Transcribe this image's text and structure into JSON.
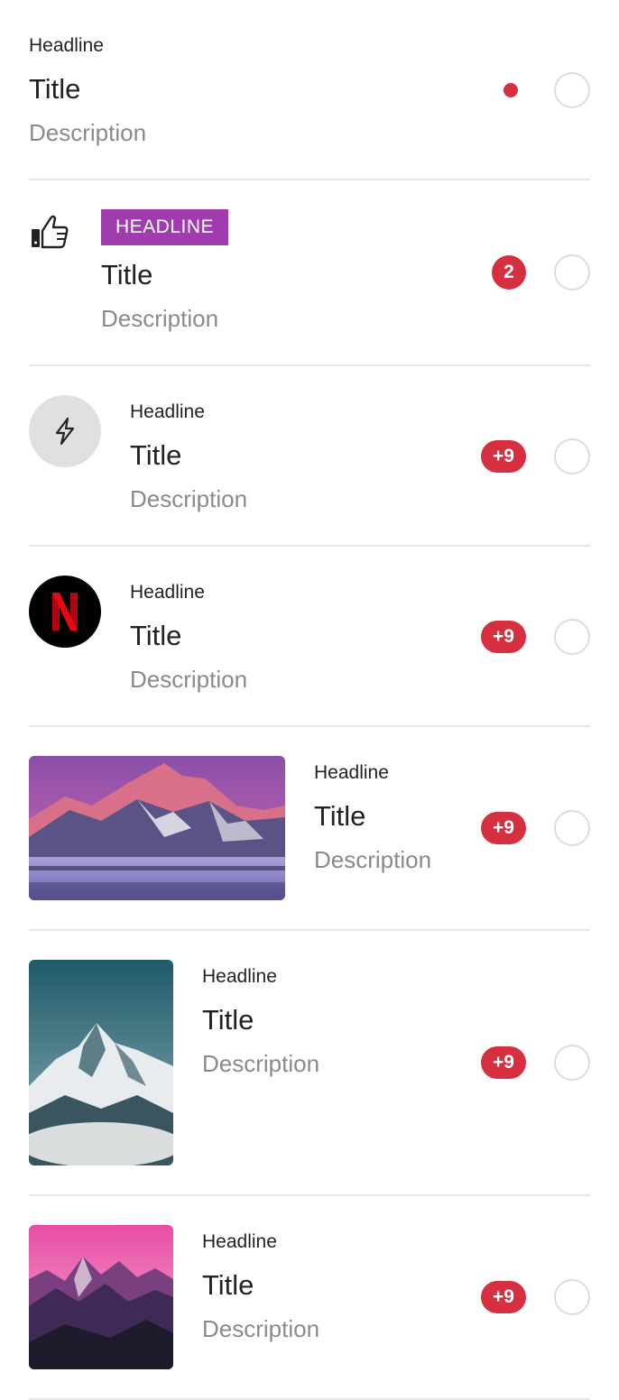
{
  "colors": {
    "badge": "#d63040",
    "tag": "#a03cad",
    "divider": "#e6e6e6",
    "description": "#8a8a8a"
  },
  "items": [
    {
      "headline": "Headline",
      "title": "Title",
      "description": "Description",
      "indicator": "dot"
    },
    {
      "headline": "HEADLINE",
      "title": "Title",
      "description": "Description",
      "icon": "thumbs-up-icon",
      "badge": "2"
    },
    {
      "headline": "Headline",
      "title": "Title",
      "description": "Description",
      "icon": "lightning-icon",
      "badge": "+9"
    },
    {
      "headline": "Headline",
      "title": "Title",
      "description": "Description",
      "icon": "netflix-logo",
      "badge": "+9"
    },
    {
      "headline": "Headline",
      "title": "Title",
      "description": "Description",
      "image": "mountain-landscape-pink",
      "badge": "+9"
    },
    {
      "headline": "Headline",
      "title": "Title",
      "description": "Description",
      "image": "snowy-mountain-peak",
      "badge": "+9"
    },
    {
      "headline": "Headline",
      "title": "Title",
      "description": "Description",
      "image": "mountain-pink-sky",
      "badge": "+9"
    }
  ]
}
